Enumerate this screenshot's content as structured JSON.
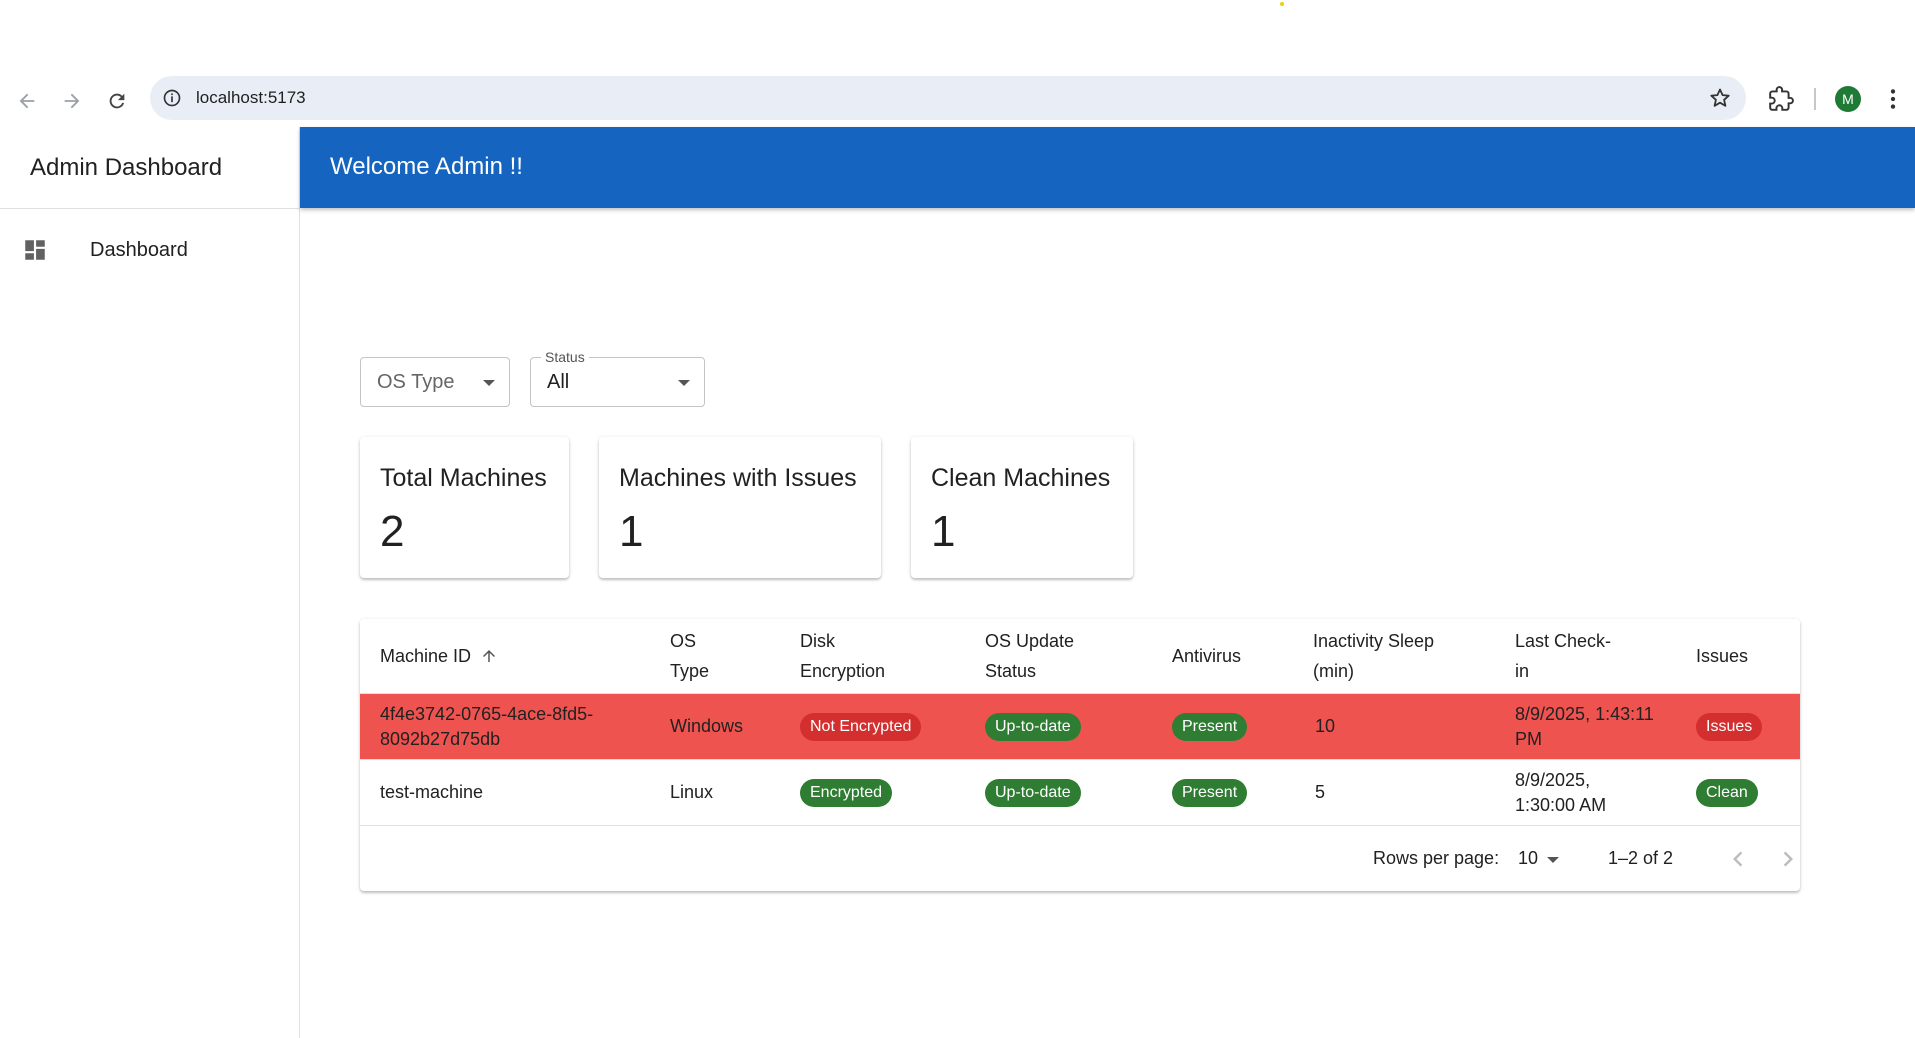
{
  "browser": {
    "url": "localhost:5173",
    "profile_initial": "M",
    "icons": [
      "back-icon",
      "forward-icon",
      "reload-icon",
      "info-icon",
      "star-icon",
      "extensions-icon",
      "more-vert-icon"
    ]
  },
  "sidebar": {
    "title": "Admin Dashboard",
    "items": [
      {
        "label": "Dashboard",
        "icon": "dashboard-icon"
      }
    ]
  },
  "appbar": {
    "title": "Welcome Admin !!"
  },
  "filters": {
    "os_type": {
      "placeholder": "OS Type"
    },
    "status": {
      "label": "Status",
      "value": "All"
    }
  },
  "stats": [
    {
      "title": "Total Machines",
      "value": "2"
    },
    {
      "title": "Machines with Issues",
      "value": "1"
    },
    {
      "title": "Clean Machines",
      "value": "1"
    }
  ],
  "table": {
    "columns": {
      "machine_id": "Machine ID",
      "os_type_1": "OS",
      "os_type_2": "Type",
      "disk_1": "Disk",
      "disk_2": "Encryption",
      "osu_1": "OS Update",
      "osu_2": "Status",
      "antivirus": "Antivirus",
      "sleep_1": "Inactivity Sleep",
      "sleep_2": "(min)",
      "checkin_1": "Last Check-",
      "checkin_2": "in",
      "issues": "Issues"
    },
    "rows": [
      {
        "machine_id_1": "4f4e3742-0765-4ace-8fd5-",
        "machine_id_2": "8092b27d75db",
        "os": "Windows",
        "disk": "Not Encrypted",
        "os_update": "Up-to-date",
        "antivirus": "Present",
        "sleep": "10",
        "checkin_1": "8/9/2025, 1:43:11",
        "checkin_2": "PM",
        "issues": "Issues"
      },
      {
        "machine_id_1": "test-machine",
        "os": "Linux",
        "disk": "Encrypted",
        "os_update": "Up-to-date",
        "antivirus": "Present",
        "sleep": "5",
        "checkin_1": "8/9/2025,",
        "checkin_2": "1:30:00 AM",
        "issues": "Clean"
      }
    ],
    "pagination": {
      "rows_per_page_label": "Rows per page:",
      "rows_per_page": "10",
      "range": "1–2 of 2"
    }
  },
  "colors": {
    "appbar": "#1565c0",
    "issue_row": "#ef5350",
    "chip_red": "#d32f2f",
    "chip_green": "#2e7d32"
  }
}
